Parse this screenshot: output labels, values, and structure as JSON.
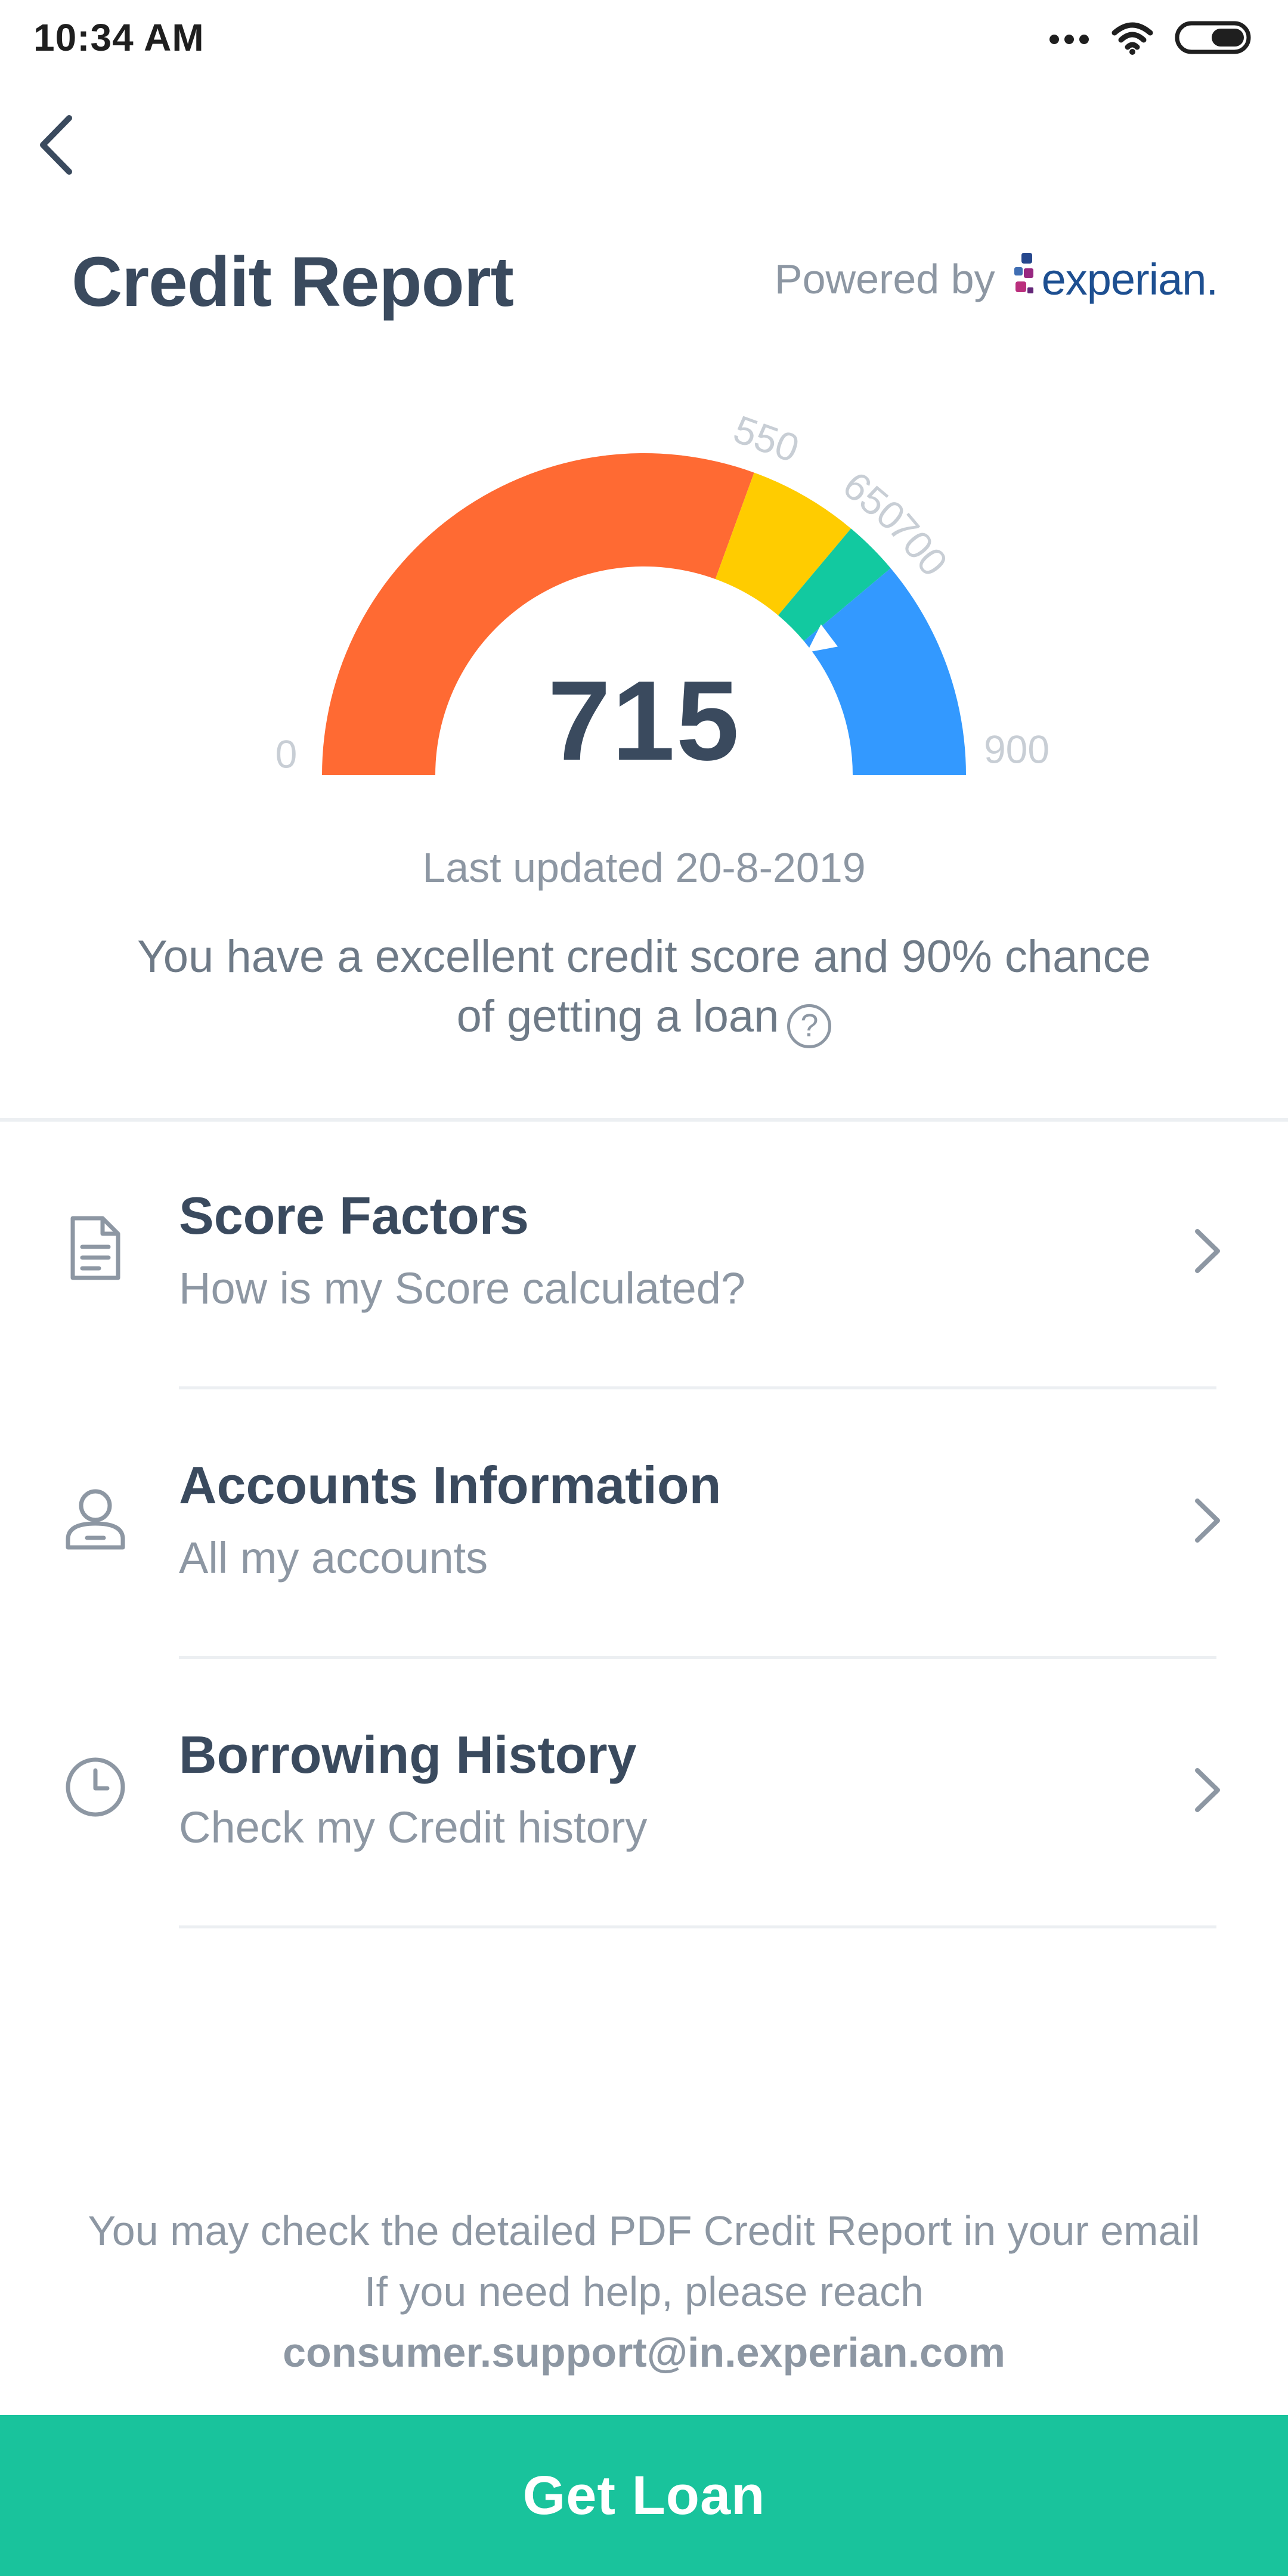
{
  "status_bar": {
    "time": "10:34 AM",
    "icons": [
      "more-dots-icon",
      "wifi-icon",
      "battery-icon"
    ]
  },
  "header": {
    "back_icon": "chevron-left-icon",
    "title": "Credit Report",
    "powered_by": "Powered by",
    "brand": "experian."
  },
  "gauge": {
    "score": "715",
    "min_label": "0",
    "max_label": "900",
    "threshold_labels": [
      "550",
      "650",
      "700"
    ],
    "min": 0,
    "max": 900,
    "score_number": 715,
    "segments": [
      {
        "from": 0,
        "to": 550,
        "color": "#ff6a33"
      },
      {
        "from": 550,
        "to": 650,
        "color": "#ffcc00"
      },
      {
        "from": 650,
        "to": 700,
        "color": "#12c9a0"
      },
      {
        "from": 700,
        "to": 900,
        "color": "#3399ff"
      }
    ]
  },
  "summary": {
    "last_updated": "Last updated 20-8-2019",
    "line1": "You have a excellent credit score and  90% chance",
    "line2": "of getting a loan",
    "help_glyph": "?"
  },
  "menu": [
    {
      "title": "Score Factors",
      "subtitle": "How is my Score calculated?",
      "icon": "document-icon"
    },
    {
      "title": "Accounts Information",
      "subtitle": "All my accounts",
      "icon": "user-icon"
    },
    {
      "title": "Borrowing History",
      "subtitle": "Check my Credit history",
      "icon": "clock-icon"
    }
  ],
  "footer": {
    "line1": "You may check the detailed PDF Credit Report in your email",
    "line2": "If you need help, please reach",
    "email": "consumer.support@in.experian.com"
  },
  "cta": {
    "label": "Get Loan"
  },
  "colors": {
    "accent": "#19c39c",
    "title": "#3a4a5e",
    "muted": "#8d97a3"
  }
}
